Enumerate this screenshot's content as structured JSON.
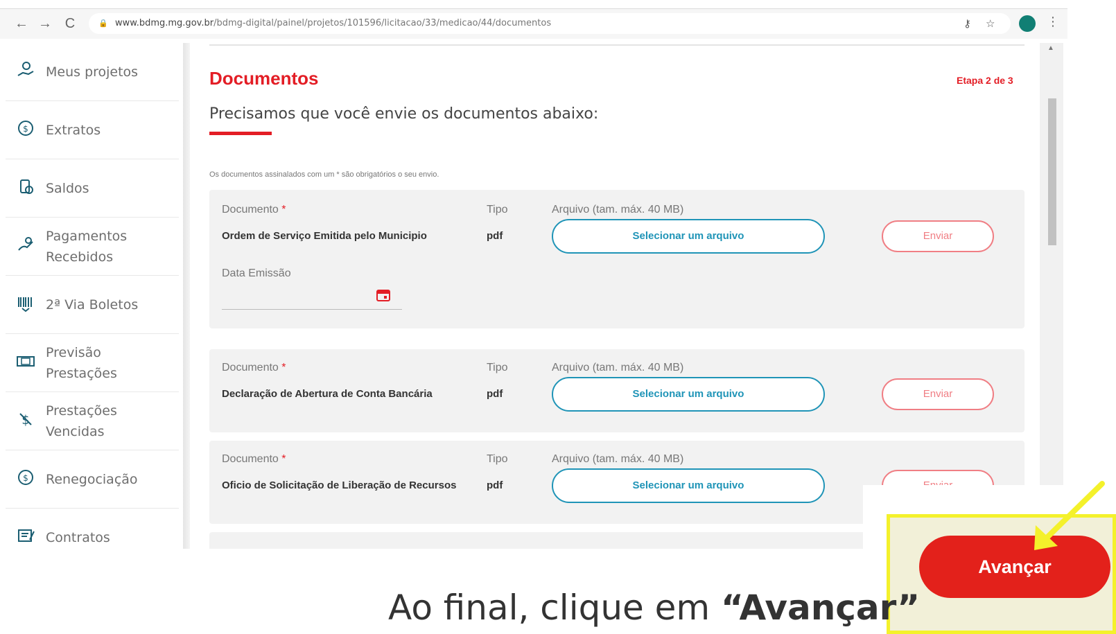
{
  "browser": {
    "back_icon": "←",
    "forward_icon": "→",
    "reload_icon": "C",
    "url_host": "www.bdmg.mg.gov.br",
    "url_path": "/bdmg-digital/painel/projetos/101596/licitacao/33/medicao/44/documentos"
  },
  "sidebar": {
    "items": [
      {
        "label": "Meus projetos",
        "icon": "hand-coin-icon"
      },
      {
        "label": "Extratos",
        "icon": "dollar-circle-icon"
      },
      {
        "label": "Saldos",
        "icon": "coins-icon"
      },
      {
        "label": "Pagamentos Recebidos",
        "icon": "hand-payment-icon"
      },
      {
        "label": "2ª Via Boletos",
        "icon": "barcode-icon"
      },
      {
        "label": "Previsão Prestações",
        "icon": "banknote-icon"
      },
      {
        "label": "Prestações Vencidas",
        "icon": "dollar-slash-icon"
      },
      {
        "label": "Renegociação",
        "icon": "refresh-dollar-icon"
      },
      {
        "label": "Contratos",
        "icon": "contract-icon"
      }
    ]
  },
  "main": {
    "title": "Documentos",
    "step": "Etapa 2 de 3",
    "subtitle": "Precisamos que você envie os documentos abaixo:",
    "note": "Os documentos assinalados com um * são obrigatórios o seu envio.",
    "labels": {
      "documento": "Documento",
      "required_mark": "*",
      "tipo": "Tipo",
      "arquivo": "Arquivo (tam. máx. 40 MB)",
      "data_emissao": "Data Emissão",
      "select_file": "Selecionar um arquivo",
      "send": "Enviar"
    },
    "documents": [
      {
        "name": "Ordem de Serviço Emitida pelo Municipio",
        "type": "pdf"
      },
      {
        "name": "Declaração de Abertura de Conta Bancária",
        "type": "pdf"
      },
      {
        "name": "Oficio de Solicitação de Liberação de Recursos",
        "type": "pdf"
      }
    ]
  },
  "callout": {
    "button_label": "Avançar",
    "caption_prefix": "Ao final, clique em ",
    "caption_quote_open": "“",
    "caption_highlight": "Avançar",
    "caption_quote_close": "”"
  },
  "colors": {
    "brand_red": "#e31d25",
    "teal": "#1f94b7",
    "highlight_yellow": "#f4f12b"
  }
}
